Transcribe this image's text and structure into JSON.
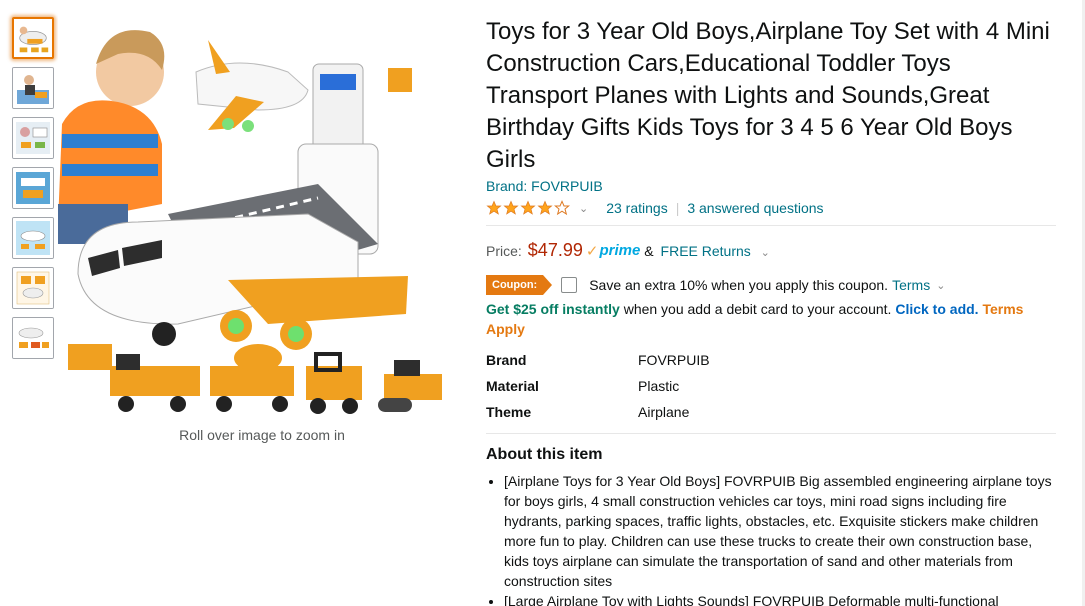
{
  "thumbnails": [
    {
      "name": "thumb-1",
      "selected": true
    },
    {
      "name": "thumb-2",
      "selected": false
    },
    {
      "name": "thumb-3",
      "selected": false
    },
    {
      "name": "thumb-4",
      "selected": false
    },
    {
      "name": "thumb-5",
      "selected": false
    },
    {
      "name": "thumb-6",
      "selected": false
    },
    {
      "name": "thumb-7",
      "selected": false
    }
  ],
  "image": {
    "zoom_hint": "Roll over image to zoom in"
  },
  "product": {
    "title": "Toys for 3 Year Old Boys,Airplane Toy Set with 4 Mini Construction Cars,Educational Toddler Toys Transport Planes with Lights and Sounds,Great Birthday Gifts Kids Toys for 3 4 5 6 Year Old Boys Girls",
    "brand_link": "Brand: FOVRPUIB",
    "rating": 4.0,
    "ratings_text": "23 ratings",
    "questions_text": "3 answered questions"
  },
  "price": {
    "label": "Price:",
    "value": "$47.99",
    "prime_label": "prime",
    "returns_prefix": "&",
    "returns_link": "FREE Returns"
  },
  "coupon": {
    "badge": "Coupon:",
    "text": "Save an extra 10% when you apply this coupon.",
    "terms": "Terms"
  },
  "offer": {
    "bold": "Get $25 off instantly",
    "text": "when you add a debit card to your account.",
    "click": "Click to add.",
    "terms_apply": "Terms Apply"
  },
  "specs": [
    {
      "key": "Brand",
      "value": "FOVRPUIB"
    },
    {
      "key": "Material",
      "value": "Plastic"
    },
    {
      "key": "Theme",
      "value": "Airplane"
    }
  ],
  "about": {
    "title": "About this item",
    "bullets": [
      "[Airplane Toys for 3 Year Old Boys] FOVRPUIB Big assembled engineering airplane toys for boys girls, 4 small construction vehicles car toys, mini road signs including fire hydrants, parking spaces, traffic lights, obstacles, etc. Exquisite stickers make children more fun to play. Children can use these trucks to create their own construction base, kids toys airplane can simulate the transportation of sand and other materials from construction sites",
      "[Large Airplane Toy with Lights Sounds] FOVRPUIB Deformable multi-functional"
    ]
  },
  "colors": {
    "link": "#007185",
    "price": "#b12704",
    "star": "#ffa41c",
    "coupon": "#e47911",
    "selected_thumb": "#e77600"
  }
}
